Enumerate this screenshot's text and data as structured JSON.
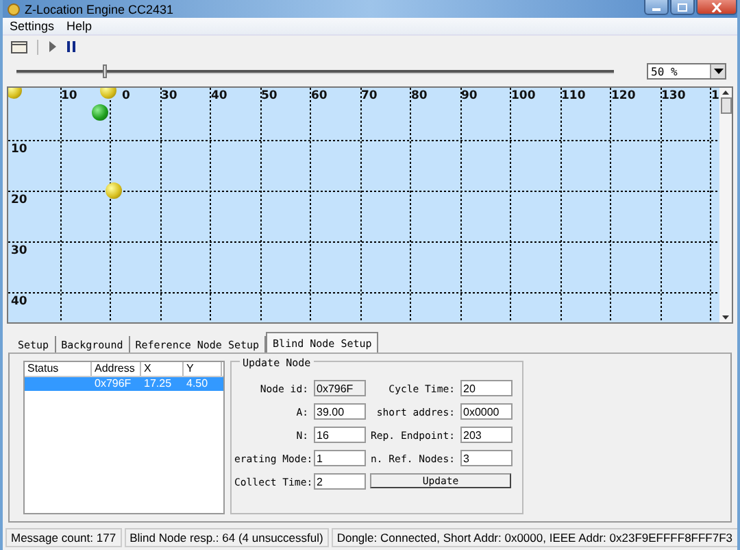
{
  "window": {
    "title": "Z-Location Engine CC2431"
  },
  "menu": [
    "Settings",
    "Help"
  ],
  "toolbar": [
    {
      "kind": "open"
    },
    {
      "kind": "play"
    },
    {
      "kind": "pause"
    }
  ],
  "zoom": {
    "level": 0.15,
    "value": "50 %"
  },
  "canvas": {
    "x_labels": [
      "10",
      "0",
      "30",
      "40",
      "50",
      "60",
      "70",
      "80",
      "90",
      "100",
      "110",
      "120",
      "130",
      "1"
    ],
    "y_labels": [
      "10",
      "20",
      "30",
      "40"
    ],
    "nodes": [
      {
        "kind": "reference"
      },
      {
        "kind": "reference"
      },
      {
        "kind": "reference"
      },
      {
        "kind": "blind"
      }
    ]
  },
  "tabs": [
    {
      "label": "Setup",
      "selected": false
    },
    {
      "label": "Background",
      "selected": false
    },
    {
      "label": "Reference Node Setup",
      "selected": false
    },
    {
      "label": "Blind Node Setup",
      "selected": true
    }
  ],
  "node_list": {
    "columns": [
      "Status",
      "Address",
      "X",
      "Y"
    ],
    "rows": [
      {
        "cells": [
          "",
          "0x796F",
          "17.25",
          "4.50"
        ],
        "selected": true
      }
    ]
  },
  "update_node": {
    "title": "Update Node",
    "left": [
      {
        "label": "Node id:",
        "value": "0x796F",
        "readonly": true
      },
      {
        "label": "A:",
        "value": "39.00",
        "readonly": false
      },
      {
        "label": "N:",
        "value": "16",
        "readonly": false
      },
      {
        "label": "erating Mode:",
        "value": "1",
        "readonly": false
      },
      {
        "label": "Collect Time:",
        "value": "2",
        "readonly": false
      }
    ],
    "right": [
      {
        "label": "Cycle Time:",
        "value": "20",
        "readonly": false
      },
      {
        "label": "short addres:",
        "value": "0x0000",
        "readonly": false
      },
      {
        "label": "Rep. Endpoint:",
        "value": "203",
        "readonly": false
      },
      {
        "label": "n. Ref. Nodes:",
        "value": "3",
        "readonly": false
      }
    ],
    "button": "Update"
  },
  "status_bar": [
    "Message count: 177",
    "Blind Node resp.: 64 (4 unsuccessful)",
    "Dongle: Connected, Short Addr: 0x0000, IEEE Addr: 0x23F9EFFFF8FFF7F3"
  ]
}
